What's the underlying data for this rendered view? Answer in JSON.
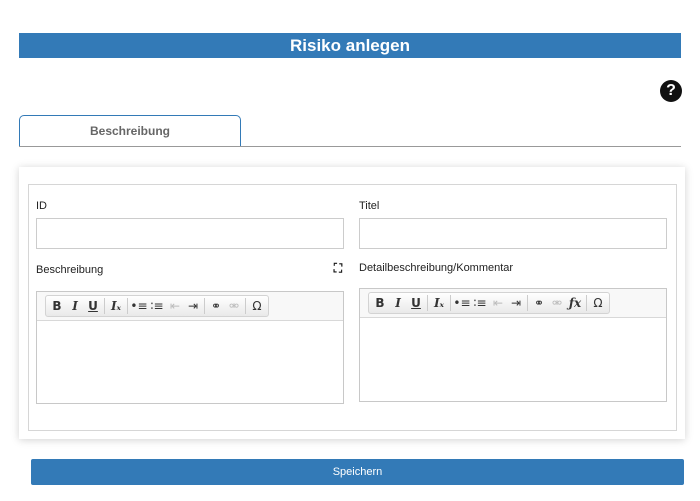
{
  "header": {
    "title": "Risiko anlegen"
  },
  "help": {
    "glyph": "?"
  },
  "tabs": [
    {
      "label": "Beschreibung"
    }
  ],
  "form": {
    "id_label": "ID",
    "id_value": "",
    "titel_label": "Titel",
    "titel_value": "",
    "beschreibung_label": "Beschreibung",
    "detail_label": "Detailbeschreibung/Kommentar"
  },
  "toolbar": {
    "bold": "B",
    "italic": "I",
    "underline": "U",
    "remove_format": "Iₓ",
    "bullet_list": "•≡",
    "numbered_list": "∶≡",
    "outdent": "⇤",
    "indent": "⇥",
    "link": "⚭",
    "unlink": "⚮",
    "formula": "ƒx",
    "special_char": "Ω"
  },
  "actions": {
    "save_label": "Speichern"
  },
  "colors": {
    "accent": "#337ab7"
  }
}
